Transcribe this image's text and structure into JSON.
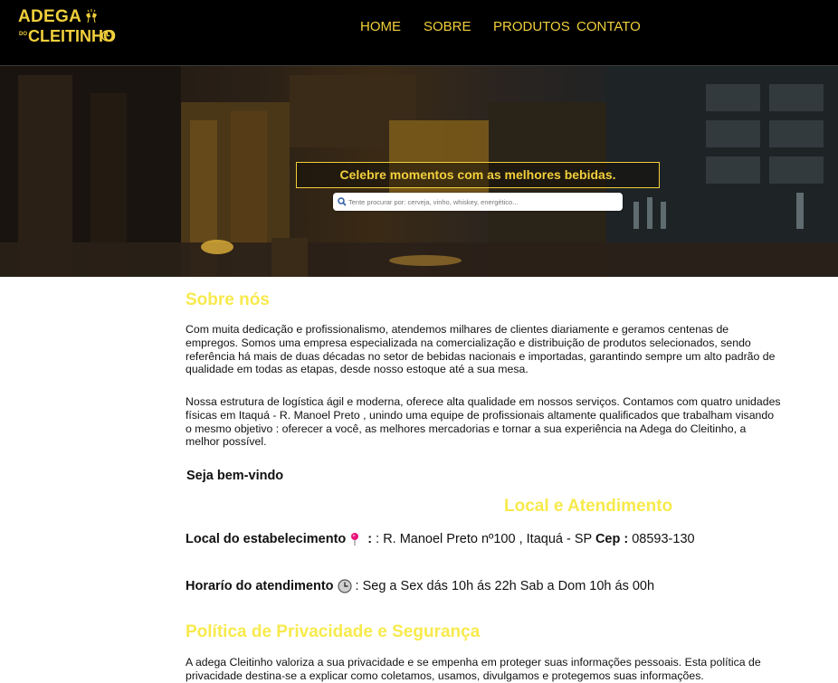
{
  "header": {
    "logo": {
      "top": "ADEGA",
      "do": "DO",
      "bottom": "CLEITINHO"
    },
    "nav": [
      {
        "label": "HOME"
      },
      {
        "label": "SOBRE"
      },
      {
        "label": "PRODUTOS"
      },
      {
        "label": "CONTATO"
      }
    ]
  },
  "hero": {
    "tagline": "Celebre momentos com as melhores bebidas.",
    "search_placeholder": "Tente procurar por: cerveja, vinho, whiskey, energético..."
  },
  "about": {
    "title": "Sobre nós",
    "p1": "Com muita dedicação e profissionalismo, atendemos milhares de clientes diariamente e geramos centenas de empregos. Somos uma empresa especializada na comercialização e distribuição de produtos selecionados, sendo referência há mais de duas décadas no setor de bebidas nacionais e importadas, garantindo sempre um alto padrão de qualidade em todas as etapas, desde nosso estoque até a sua mesa.",
    "p2": "Nossa estrutura de logística ágil e moderna, oferece alta qualidade em nossos serviços. Contamos com quatro unidades físicas em Itaquá - R. Manoel Preto , unindo uma equipe de profissionais altamente qualificados que trabalham visando o mesmo objetivo : oferecer a você, as melhores mercadorias e tornar a sua experiência na Adega do Cleitinho, a melhor possível.",
    "welcome": "Seja bem-vindo"
  },
  "location": {
    "title": "Local e Atendimento",
    "address_label": "Local do estabelecimento",
    "address": ": R. Manoel Preto nº100 , Itaquá - SP",
    "cep_label": "Cep :",
    "cep": "08593-130",
    "hours_label": "Horarío do atendimento",
    "hours": ": Seg a Sex dás 10h ás 22h Sab a Dom 10h ás 00h"
  },
  "privacy": {
    "title": "Política de Privacidade e Segurança",
    "p1": "A adega Cleitinho valoriza a sua privacidade e se empenha em proteger suas informações pessoais. Esta política de privacidade destina-se a explicar como coletamos, usamos, divulgamos e protegemos suas informações."
  },
  "colors": {
    "accent": "#f1cf3b",
    "heading": "#f7ea4c",
    "header_bg": "#000000"
  },
  "icons": [
    "glasses-icon",
    "clock-icon",
    "search-icon",
    "pin-icon",
    "clock-icon"
  ]
}
